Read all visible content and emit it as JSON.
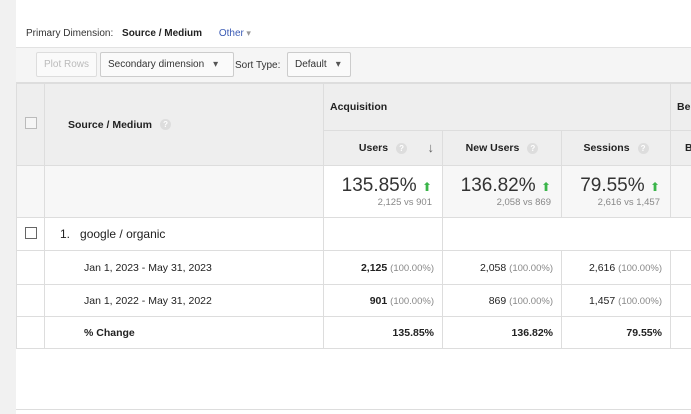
{
  "primary_dimension": {
    "label": "Primary Dimension:",
    "value": "Source / Medium",
    "other": "Other"
  },
  "toolbar": {
    "plot_rows": "Plot Rows",
    "secondary_dimension": "Secondary dimension",
    "sort_type_label": "Sort Type:",
    "sort_type_value": "Default"
  },
  "table": {
    "dimension_header": "Source / Medium",
    "group_acquisition": "Acquisition",
    "group_behavior": "Bel",
    "columns": [
      "Users",
      "New Users",
      "Sessions",
      "B"
    ],
    "summary": [
      {
        "change": "135.85%",
        "compare": "2,125 vs 901"
      },
      {
        "change": "136.82%",
        "compare": "2,058 vs 869"
      },
      {
        "change": "79.55%",
        "compare": "2,616 vs 1,457"
      }
    ],
    "row": {
      "index": "1.",
      "name": "google / organic"
    },
    "subrows": [
      {
        "label": "Jan 1, 2023 - May 31, 2023",
        "values": [
          {
            "v": "2,125",
            "p": "(100.00%)"
          },
          {
            "v": "2,058",
            "p": "(100.00%)"
          },
          {
            "v": "2,616",
            "p": "(100.00%)"
          }
        ]
      },
      {
        "label": "Jan 1, 2022 - May 31, 2022",
        "values": [
          {
            "v": "901",
            "p": "(100.00%)"
          },
          {
            "v": "869",
            "p": "(100.00%)"
          },
          {
            "v": "1,457",
            "p": "(100.00%)"
          }
        ]
      }
    ],
    "change_row": {
      "label": "% Change",
      "values": [
        "135.85%",
        "136.82%",
        "79.55%"
      ]
    }
  }
}
